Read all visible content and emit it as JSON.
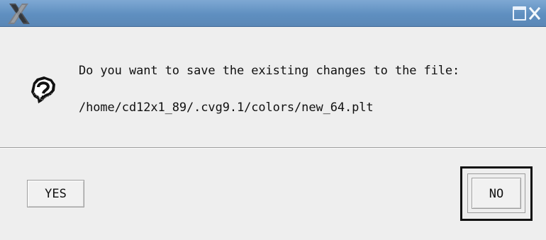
{
  "window": {
    "app_icon_name": "x-window-icon",
    "maximize_icon_name": "maximize-icon",
    "close_icon_name": "close-icon"
  },
  "message": {
    "question_icon_name": "question-icon",
    "line1": "Do you want to save the existing changes to the file:",
    "line2": "/home/cd12x1_89/.cvg9.1/colors/new_64.plt"
  },
  "buttons": {
    "yes": "YES",
    "no": "NO"
  },
  "colors": {
    "titlebar": "#5f8fc0",
    "background": "#eeeeee",
    "text": "#111111"
  }
}
